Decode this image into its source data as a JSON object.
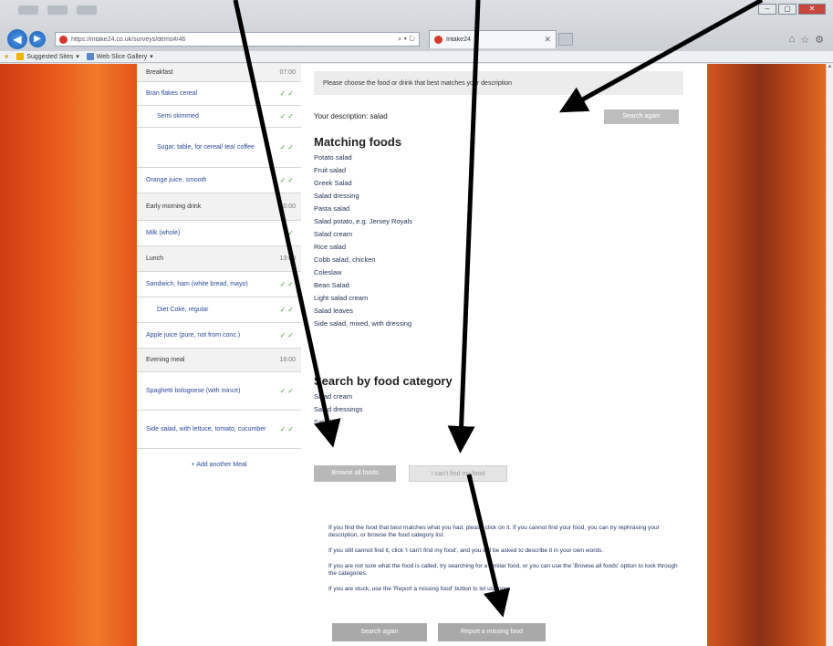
{
  "browser": {
    "address_text": "https://intake24.co.uk/surveys/demo#/46",
    "tab_title": "Intake24",
    "favorites": [
      {
        "icon": "folder-star-icon",
        "label": "Suggested Sites"
      },
      {
        "icon": "web-slice-icon",
        "label": "Web Slice Gallery"
      }
    ]
  },
  "leftnav": {
    "items": [
      {
        "label": "Breakfast",
        "status": "07:00",
        "kind": "section",
        "height": 20
      },
      {
        "label": "Bran flakes cereal",
        "status": "✓✓",
        "kind": "item",
        "height": 26
      },
      {
        "label": "Semi skimmed",
        "status": "✓✓",
        "kind": "sub",
        "height": 24
      },
      {
        "label": "Sugar, table, for cereal/ tea/ coffee",
        "status": "✓✓",
        "kind": "sub",
        "height": 44
      },
      {
        "label": "Orange juice, smooth",
        "status": "✓✓",
        "kind": "item",
        "height": 28
      },
      {
        "label": "Early morning drink",
        "status": "10:00",
        "kind": "section",
        "height": 30
      },
      {
        "label": "Milk (whole)",
        "status": "✓",
        "kind": "item",
        "height": 28
      },
      {
        "label": "Lunch",
        "status": "13:00",
        "kind": "section",
        "height": 28
      },
      {
        "label": "Sandwich, ham (white bread, mayo)",
        "status": "✓✓",
        "kind": "item",
        "height": 28
      },
      {
        "label": "Diet Coke, regular",
        "status": "✓✓",
        "kind": "sub",
        "height": 28
      },
      {
        "label": "Apple juice (pure, not from conc.)",
        "status": "✓✓",
        "kind": "item",
        "height": 28
      },
      {
        "label": "Evening meal",
        "status": "18:00",
        "kind": "section",
        "height": 26
      },
      {
        "label": "Spaghetti bolognese (with mince)",
        "status": "✓✓",
        "kind": "item",
        "height": 42
      },
      {
        "label": "Side salad, with lettuce, tomato, cucumber",
        "status": "✓✓",
        "kind": "item",
        "height": 42
      }
    ],
    "add_another": "+ Add another Meal"
  },
  "main": {
    "prompt": "Please choose the food or drink that best matches your description",
    "search_value": "Your description: salad",
    "search_again_label": "Search again",
    "matching_heading": "Matching foods",
    "foods": [
      "Potato salad",
      "Fruit salad",
      "Greek Salad",
      "Salad dressing",
      "Pasta salad",
      "Salad potato, e.g. Jersey Royals",
      "Salad cream",
      "Rice salad",
      "Cobb salad, chicken",
      "Coleslaw",
      "Bean Salad",
      "Light salad cream",
      "Salad leaves",
      "Side salad, mixed, with dressing"
    ],
    "category_heading": "Search by food category",
    "categories": [
      "Salad cream",
      "Salad dressings",
      "Salads"
    ],
    "browse_all_label": "Browse all foods",
    "cant_find_label": "I can't find my food"
  },
  "help": {
    "paragraphs": [
      "If you find the food that best matches what you had, please click on it. If you cannot find your food, you can try rephrasing your description, or browse the food category list.",
      "If you still cannot find it, click 'I can't find my food', and you will be asked to describe it in your own words.",
      "If you are not sure what the food is called, try searching for a similar food, or you can use the 'Browse all foods' option to look through the categories.",
      "If you are stuck, use the 'Report a missing food' button to let us know."
    ],
    "try_again_label": "Search again",
    "report_label": "Report a missing food"
  },
  "colors": {
    "background_orange": "#e85a1c",
    "check_green": "#4aa13a",
    "link_blue": "#2a4a9a",
    "button_grey": "#b8b8b8"
  }
}
